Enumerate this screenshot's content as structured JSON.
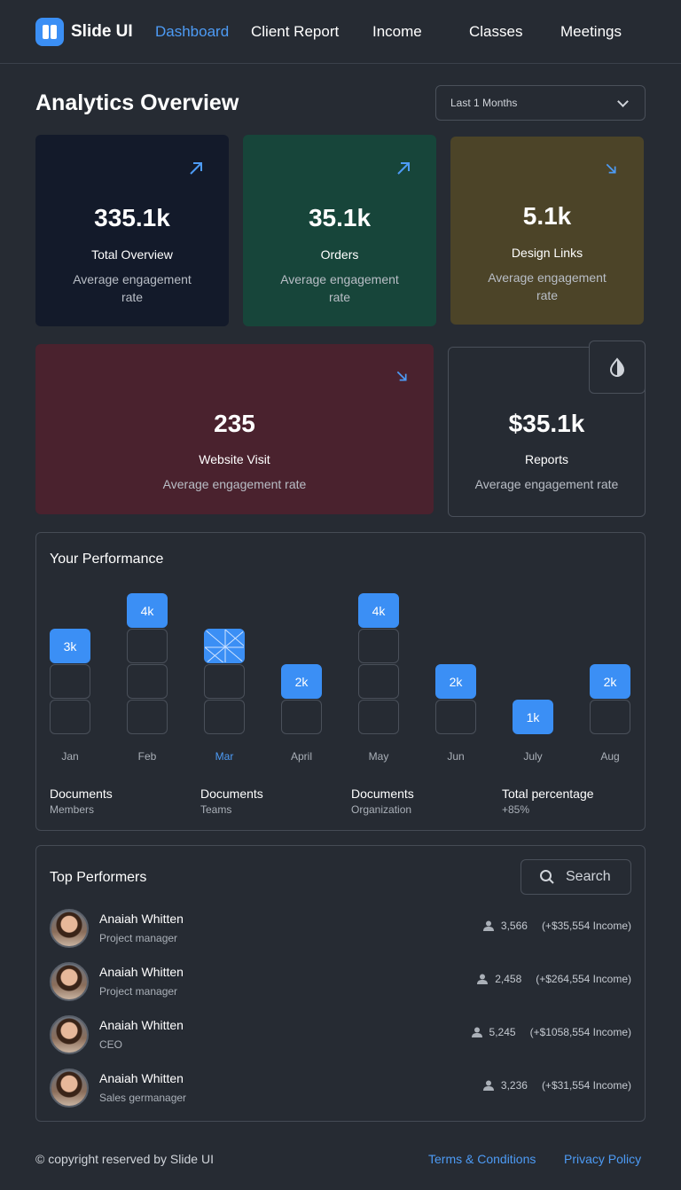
{
  "brand": {
    "name": "Slide UI"
  },
  "nav": [
    {
      "label": "Dashboard",
      "active": true
    },
    {
      "label": "Client Report"
    },
    {
      "label": "Income"
    },
    {
      "label": "Classes"
    },
    {
      "label": "Meetings"
    }
  ],
  "page": {
    "title": "Analytics Overview"
  },
  "range": {
    "value": "Last 1 Months"
  },
  "cards": [
    {
      "value": "335.1k",
      "label": "Total Overview",
      "sub": "Average engagement rate",
      "trend": "up",
      "bg": "#131a2a"
    },
    {
      "value": "35.1k",
      "label": "Orders",
      "sub": "Average engagement rate",
      "trend": "up",
      "bg": "#17453a"
    },
    {
      "value": "5.1k",
      "label": "Design Links",
      "sub": "Average engagement rate",
      "trend": "down",
      "bg": "#4c4428"
    },
    {
      "value": "235",
      "label": "Website Visit",
      "sub": "Average engagement rate",
      "trend": "down",
      "bg": "#4a222e"
    },
    {
      "value": "$35.1k",
      "label": "Reports",
      "sub": "Average engagement rate",
      "icon": "droplet-icon"
    }
  ],
  "performance": {
    "title": "Your Performance",
    "months": [
      {
        "label": "Jan",
        "value": "3k",
        "level": 3
      },
      {
        "label": "Feb",
        "value": "4k",
        "level": 4
      },
      {
        "label": "Mar",
        "value": "",
        "level": 3,
        "active": true
      },
      {
        "label": "April",
        "value": "2k",
        "level": 2
      },
      {
        "label": "May",
        "value": "4k",
        "level": 4
      },
      {
        "label": "Jun",
        "value": "2k",
        "level": 2
      },
      {
        "label": "July",
        "value": "1k",
        "level": 1
      },
      {
        "label": "Aug",
        "value": "2k",
        "level": 2
      }
    ],
    "stats": [
      {
        "title": "Documents",
        "sub": "Members"
      },
      {
        "title": "Documents",
        "sub": "Teams"
      },
      {
        "title": "Documents",
        "sub": "Organization"
      },
      {
        "title": "Total percentage",
        "sub": "+85%"
      }
    ]
  },
  "performers": {
    "title": "Top Performers",
    "search_label": "Search",
    "rows": [
      {
        "name": "Anaiah Whitten",
        "role": "Project manager",
        "count": "3,566",
        "income": "(+$35,554 Income)"
      },
      {
        "name": "Anaiah Whitten",
        "role": "Project manager",
        "count": "2,458",
        "income": "(+$264,554 Income)"
      },
      {
        "name": "Anaiah Whitten",
        "role": "CEO",
        "count": "5,245",
        "income": "(+$1058,554 Income)"
      },
      {
        "name": "Anaiah Whitten",
        "role": "Sales germanager",
        "count": "3,236",
        "income": "(+$31,554 Income)"
      }
    ]
  },
  "footer": {
    "copyright": "© copyright reserved by Slide UI",
    "terms": "Terms & Conditions",
    "privacy": "Privacy Policy"
  },
  "colors": {
    "accent": "#3b8ff5",
    "background": "#262b33"
  }
}
